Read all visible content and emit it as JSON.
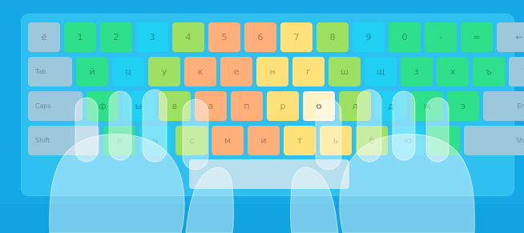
{
  "keyboard": {
    "rows": [
      {
        "name": "number-row",
        "keys": [
          {
            "label": "ё",
            "color": "#9dc8dc",
            "w": 40
          },
          {
            "label": "1",
            "color": "#2ee08a",
            "w": 40
          },
          {
            "label": "2",
            "color": "#2ee08a",
            "w": 40
          },
          {
            "label": "3",
            "color": "#1fd0f2",
            "w": 40
          },
          {
            "label": "4",
            "color": "#9ee061",
            "w": 40
          },
          {
            "label": "5",
            "color": "#ffb07a",
            "w": 40
          },
          {
            "label": "6",
            "color": "#ffb07a",
            "w": 40
          },
          {
            "label": "7",
            "color": "#ffe17a",
            "w": 40
          },
          {
            "label": "8",
            "color": "#9ee061",
            "w": 40
          },
          {
            "label": "9",
            "color": "#1fd0f2",
            "w": 40
          },
          {
            "label": "0",
            "color": "#2ee08a",
            "w": 40
          },
          {
            "label": "-",
            "color": "#2ee08a",
            "w": 40
          },
          {
            "label": "=",
            "color": "#2ee08a",
            "w": 40
          },
          {
            "label": "←",
            "color": "#9dc8dc",
            "w": 56
          }
        ]
      },
      {
        "name": "top-letter-row",
        "keys": [
          {
            "label": "Tab",
            "color": "#9dc8dc",
            "w": 55,
            "align": "left"
          },
          {
            "label": "й",
            "color": "#2ee08a",
            "w": 40
          },
          {
            "label": "ц",
            "color": "#1fd0f2",
            "w": 40
          },
          {
            "label": "у",
            "color": "#9ee061",
            "w": 40
          },
          {
            "label": "к",
            "color": "#ffb07a",
            "w": 40
          },
          {
            "label": "е",
            "color": "#ffb07a",
            "w": 40
          },
          {
            "label": "н",
            "color": "#ffe17a",
            "w": 40
          },
          {
            "label": "г",
            "color": "#ffe17a",
            "w": 40
          },
          {
            "label": "ш",
            "color": "#9ee061",
            "w": 40
          },
          {
            "label": "щ",
            "color": "#1fd0f2",
            "w": 40
          },
          {
            "label": "з",
            "color": "#2ee08a",
            "w": 40
          },
          {
            "label": "х",
            "color": "#2ee08a",
            "w": 40
          },
          {
            "label": "ъ",
            "color": "#2ee08a",
            "w": 40
          },
          {
            "label": "\\",
            "color": "#9dc8dc",
            "w": 41
          }
        ]
      },
      {
        "name": "home-row",
        "keys": [
          {
            "label": "Caps",
            "color": "#9dc8dc",
            "w": 68,
            "align": "left"
          },
          {
            "label": "ф",
            "color": "#2ee08a",
            "w": 40
          },
          {
            "label": "ы",
            "color": "#1fd0f2",
            "w": 40
          },
          {
            "label": "в",
            "color": "#9ee061",
            "w": 40
          },
          {
            "label": "а",
            "color": "#ffb07a",
            "w": 40
          },
          {
            "label": "п",
            "color": "#ffb07a",
            "w": 40
          },
          {
            "label": "р",
            "color": "#ffe17a",
            "w": 40
          },
          {
            "label": "о",
            "color": "#fff3c4",
            "w": 40,
            "highlight": true
          },
          {
            "label": "л",
            "color": "#9ee061",
            "w": 40
          },
          {
            "label": "д",
            "color": "#1fd0f2",
            "w": 40
          },
          {
            "label": "ж",
            "color": "#2ee08a",
            "w": 40
          },
          {
            "label": "э",
            "color": "#2ee08a",
            "w": 40
          },
          {
            "label": "Enter",
            "color": "#9dc8dc",
            "w": 73,
            "align": "right"
          }
        ]
      },
      {
        "name": "bottom-letter-row",
        "keys": [
          {
            "label": "Shift",
            "color": "#9dc8dc",
            "w": 89,
            "align": "left"
          },
          {
            "label": "я",
            "color": "#2ee08a",
            "w": 40
          },
          {
            "label": "ч",
            "color": "#1fd0f2",
            "w": 40
          },
          {
            "label": "с",
            "color": "#9ee061",
            "w": 40
          },
          {
            "label": "м",
            "color": "#ffb07a",
            "w": 40
          },
          {
            "label": "и",
            "color": "#ffb07a",
            "w": 40
          },
          {
            "label": "т",
            "color": "#ffe17a",
            "w": 40
          },
          {
            "label": "ь",
            "color": "#ffe17a",
            "w": 40
          },
          {
            "label": "б",
            "color": "#9ee061",
            "w": 40
          },
          {
            "label": "ю",
            "color": "#1fd0f2",
            "w": 40
          },
          {
            "label": ".",
            "color": "#2ee08a",
            "w": 40
          },
          {
            "label": "Shift",
            "color": "#9dc8dc",
            "w": 92,
            "align": "right"
          }
        ]
      }
    ],
    "highlight_key": "о"
  },
  "colors": {
    "background": "#14a9e4",
    "board": "#2ec0f1",
    "space_bar": "#b8dfee",
    "hand_overlay": "#ffffff"
  }
}
